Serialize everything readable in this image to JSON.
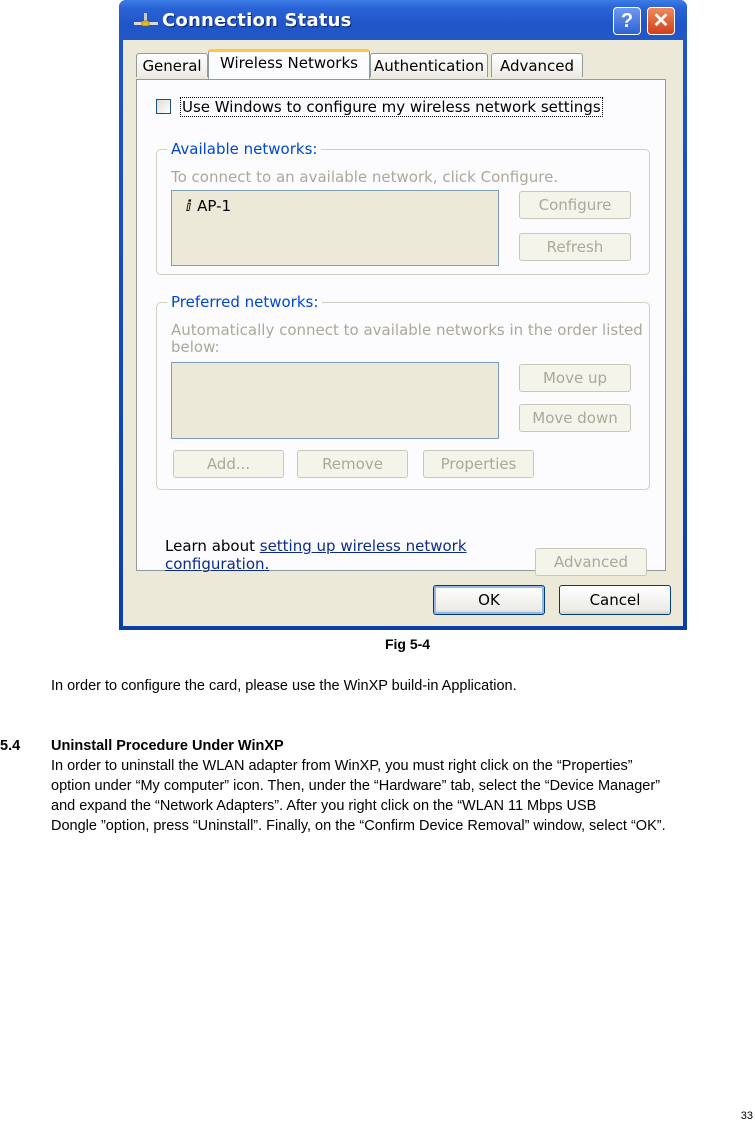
{
  "dialog": {
    "title": "Connection Status",
    "title_icon": "network-connection-icon",
    "help_label": "?",
    "close_label": "✕",
    "tabs": [
      {
        "label": "General",
        "active": false
      },
      {
        "label": "Wireless Networks",
        "active": true
      },
      {
        "label": "Authentication",
        "active": false
      },
      {
        "label": "Advanced",
        "active": false
      }
    ],
    "use_windows_checkbox": {
      "label": "Use Windows to configure my wireless network settings",
      "checked": false
    },
    "available": {
      "title": "Available networks:",
      "hint": "To connect to an available network, click Configure.",
      "networks": [
        {
          "name": "AP-1",
          "icon": "antenna-icon"
        }
      ],
      "configure_label": "Configure",
      "refresh_label": "Refresh"
    },
    "preferred": {
      "title": "Preferred networks:",
      "hint_line1": "Automatically connect to available networks in the order listed",
      "hint_line2": "below:",
      "move_up_label": "Move up",
      "move_down_label": "Move down",
      "add_label": "Add...",
      "remove_label": "Remove",
      "properties_label": "Properties"
    },
    "learn": {
      "prefix": "Learn about ",
      "link": "setting up wireless network configuration."
    },
    "advanced_label": "Advanced",
    "ok_label": "OK",
    "cancel_label": "Cancel"
  },
  "document": {
    "caption": "Fig 5-4",
    "intro": "In order to configure the card, please use the WinXP build-in Application.",
    "section_number": "5.4",
    "section_title": "Uninstall Procedure Under WinXP",
    "body_lines": [
      "In order to uninstall the WLAN adapter from WinXP, you must right click on the “Properties”",
      "option under “My computer” icon. Then, under the “Hardware” tab, select the “Device Manager”",
      "and expand the “Network Adapters”. After you right click on the “WLAN 11 Mbps USB",
      "Dongle ”option, press “Uninstall”. Finally, on the “Confirm Device Removal” window, select “OK”."
    ],
    "page_number": "33"
  }
}
